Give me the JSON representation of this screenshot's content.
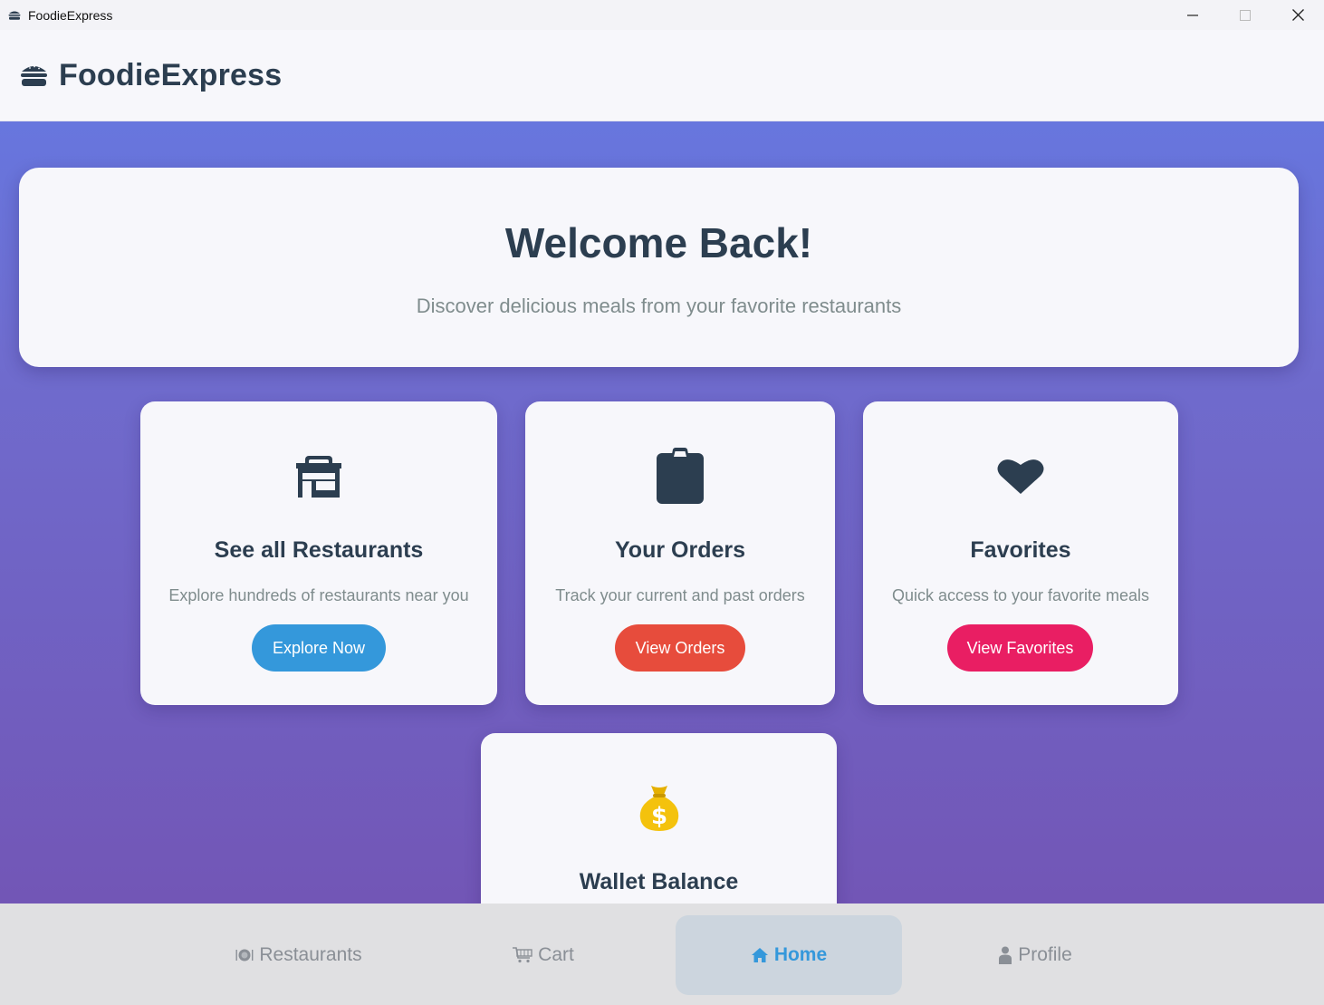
{
  "window": {
    "title": "FoodieExpress"
  },
  "header": {
    "brand": "FoodieExpress"
  },
  "welcome": {
    "title": "Welcome Back!",
    "subtitle": "Discover delicious meals from your favorite restaurants"
  },
  "cards": {
    "restaurants": {
      "icon": "storefront-icon",
      "title": "See all Restaurants",
      "description": "Explore hundreds of restaurants near you",
      "button": "Explore Now",
      "button_color": "#3498db"
    },
    "orders": {
      "icon": "clipboard-icon",
      "title": "Your Orders",
      "description": "Track your current and past orders",
      "button": "View Orders",
      "button_color": "#e74c3c"
    },
    "favorites": {
      "icon": "heart-icon",
      "title": "Favorites",
      "description": "Quick access to your favorite meals",
      "button": "View Favorites",
      "button_color": "#e91e63"
    },
    "wallet": {
      "icon": "money-bag-icon",
      "title": "Wallet Balance"
    }
  },
  "bottom_nav": {
    "items": [
      {
        "label": "Restaurants",
        "icon": "plate-icon",
        "active": false
      },
      {
        "label": "Cart",
        "icon": "cart-icon",
        "active": false
      },
      {
        "label": "Home",
        "icon": "home-icon",
        "active": true
      },
      {
        "label": "Profile",
        "icon": "person-icon",
        "active": false
      }
    ]
  },
  "colors": {
    "primary_text": "#2c3e50",
    "muted_text": "#7f8c8d",
    "accent": "#3498db",
    "gradient_top": "#6776de",
    "gradient_bottom": "#7256b6"
  }
}
